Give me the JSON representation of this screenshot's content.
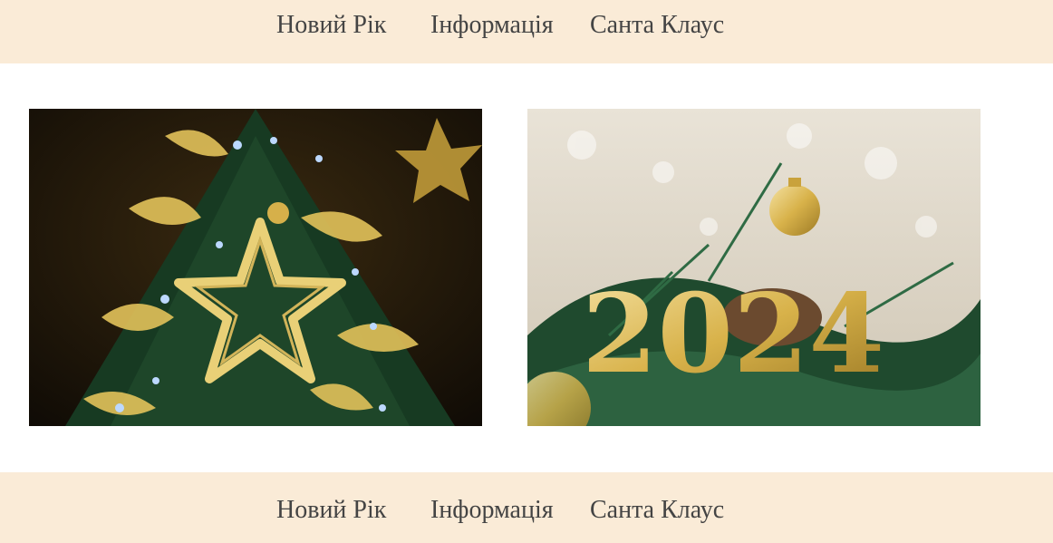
{
  "nav_top": {
    "items": [
      "Новий Рік",
      "Інформація",
      "Санта Клаус"
    ]
  },
  "gallery": {
    "images": [
      {
        "name": "christmas-tree-photo",
        "year_text": ""
      },
      {
        "name": "new-year-2024-photo",
        "year_text": "2024"
      }
    ]
  },
  "nav_bottom": {
    "items": [
      "Новий Рік",
      "Інформація",
      "Санта Клаус"
    ]
  },
  "colors": {
    "nav_background": "#faebd7",
    "nav_text": "#444444",
    "gold": "#d8b24a",
    "pine": "#1f4a2e"
  }
}
